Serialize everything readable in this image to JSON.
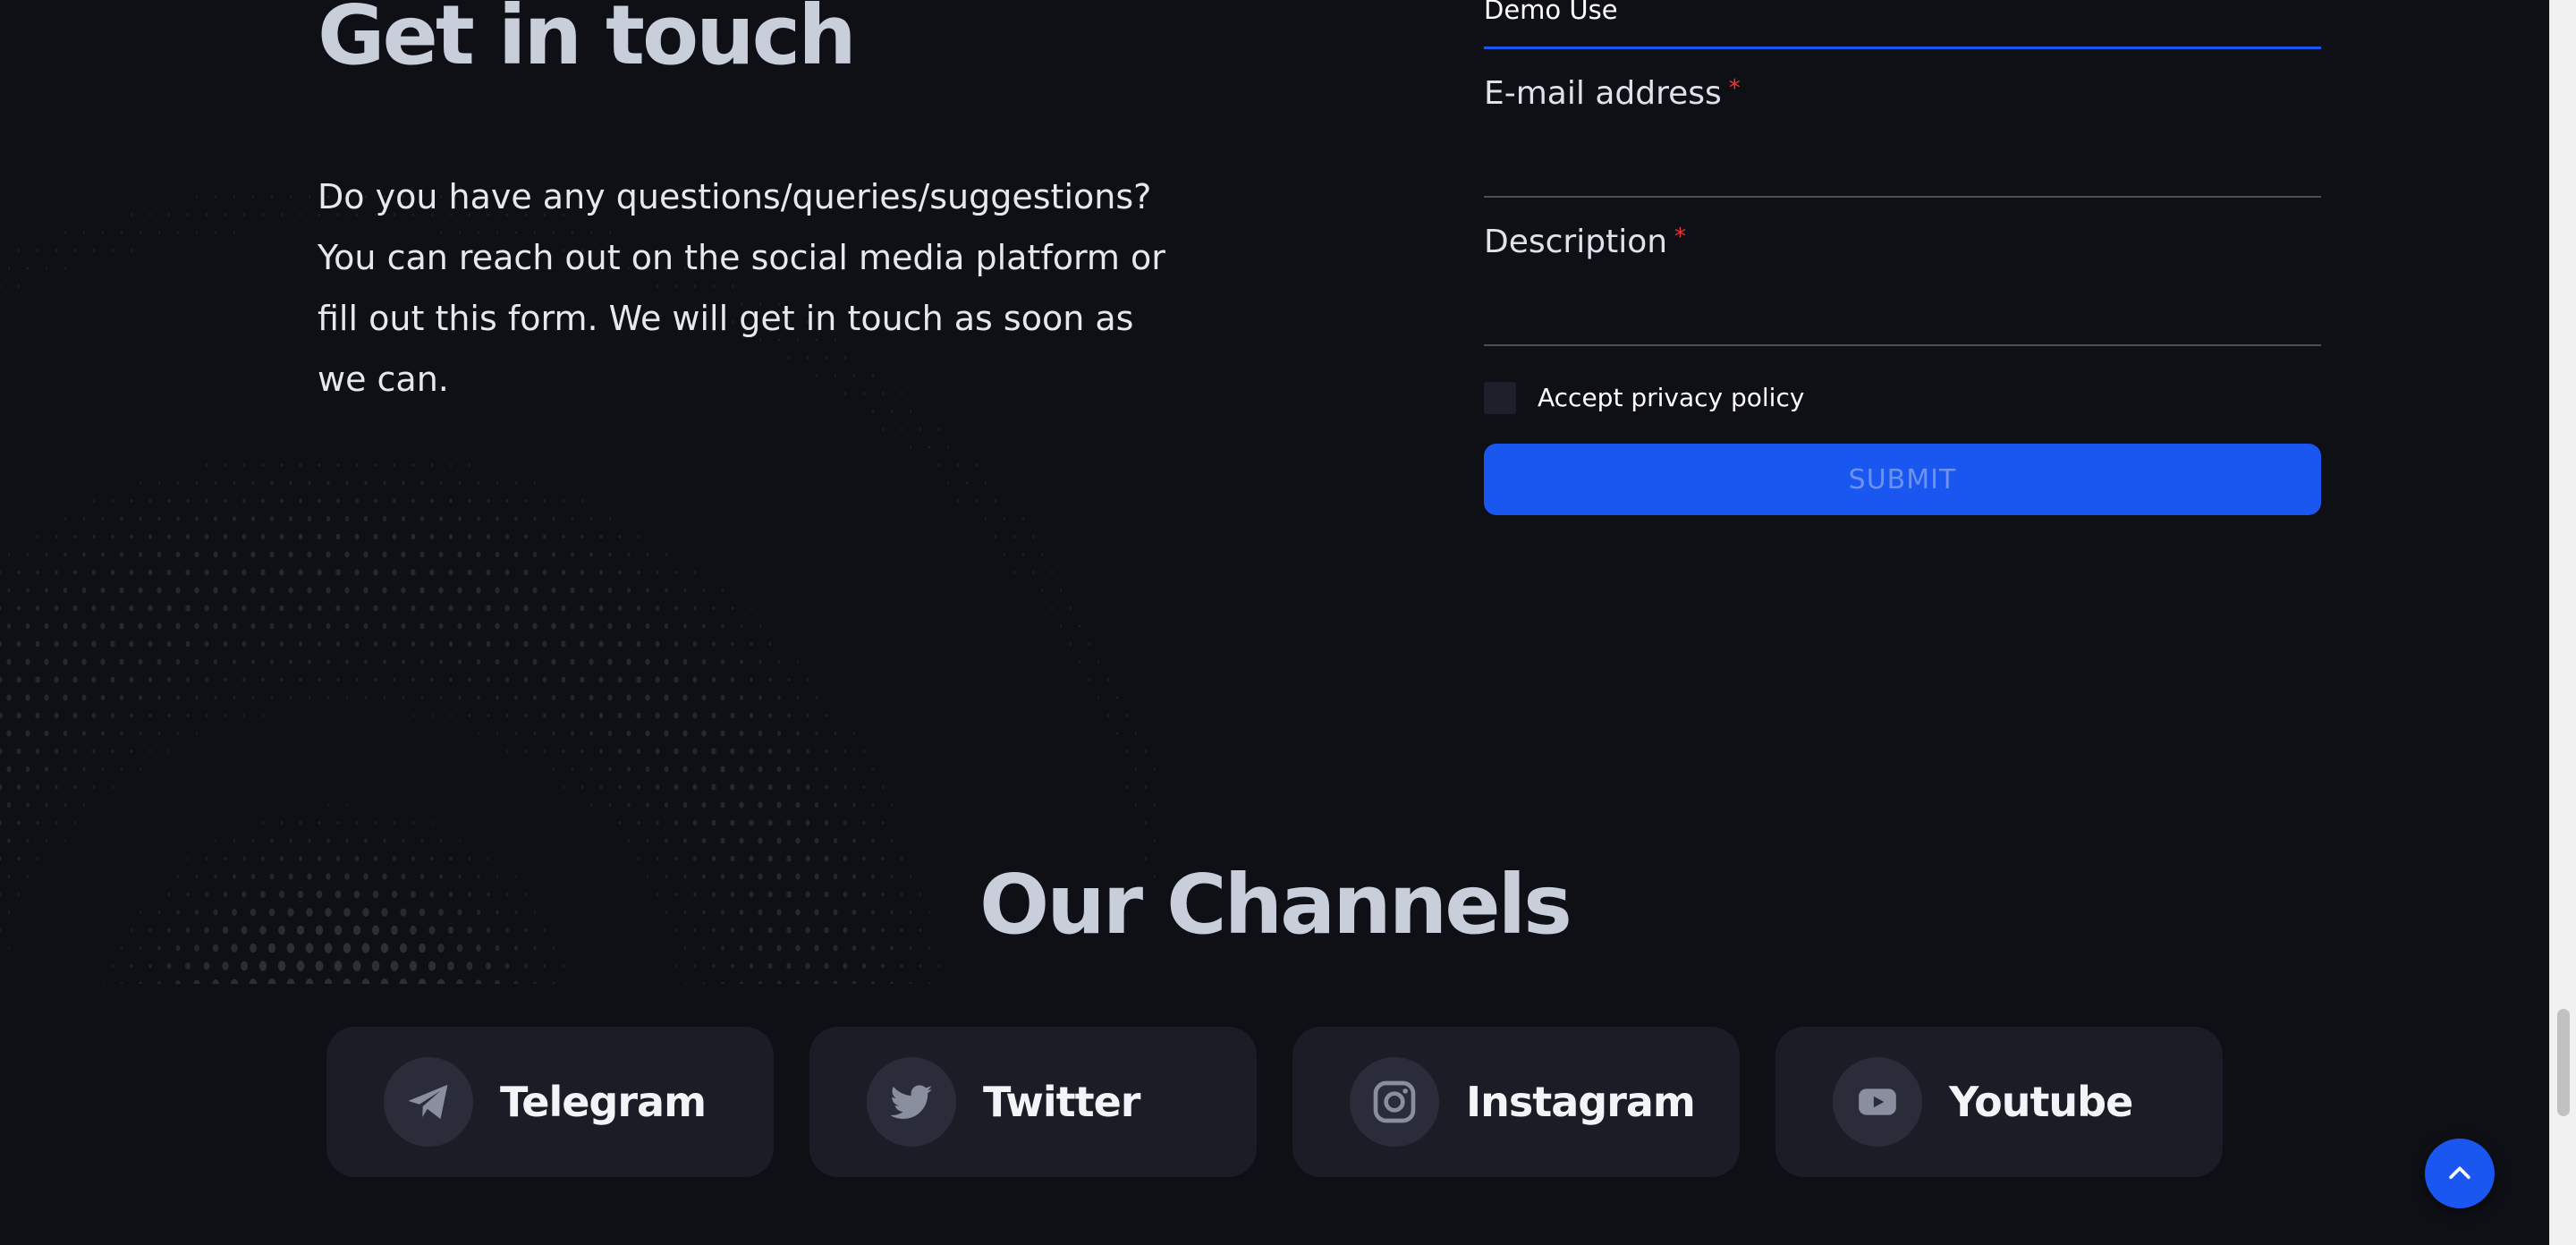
{
  "contact": {
    "title": "Get in touch",
    "description": "Do you have any questions/queries/suggestions? You can reach out on the social media platform or fill out this form. We will get in touch as soon as we can."
  },
  "form": {
    "name_value": "Demo Use",
    "email_label": "E-mail address",
    "description_label": "Description",
    "required_marker": "*",
    "privacy_label": "Accept privacy policy",
    "submit_label": "SUBMIT"
  },
  "channels": {
    "title": "Our Channels",
    "items": [
      {
        "label": "Telegram",
        "icon": "telegram-icon"
      },
      {
        "label": "Twitter",
        "icon": "twitter-icon"
      },
      {
        "label": "Instagram",
        "icon": "instagram-icon"
      },
      {
        "label": "Youtube",
        "icon": "youtube-icon"
      }
    ]
  },
  "colors": {
    "background": "#0f1016",
    "accent": "#1a56f0",
    "card": "#1a1c26",
    "heading": "#c9cedb",
    "required": "#ee3333"
  },
  "icons": {
    "back_to_top": "chevron-up-icon"
  }
}
